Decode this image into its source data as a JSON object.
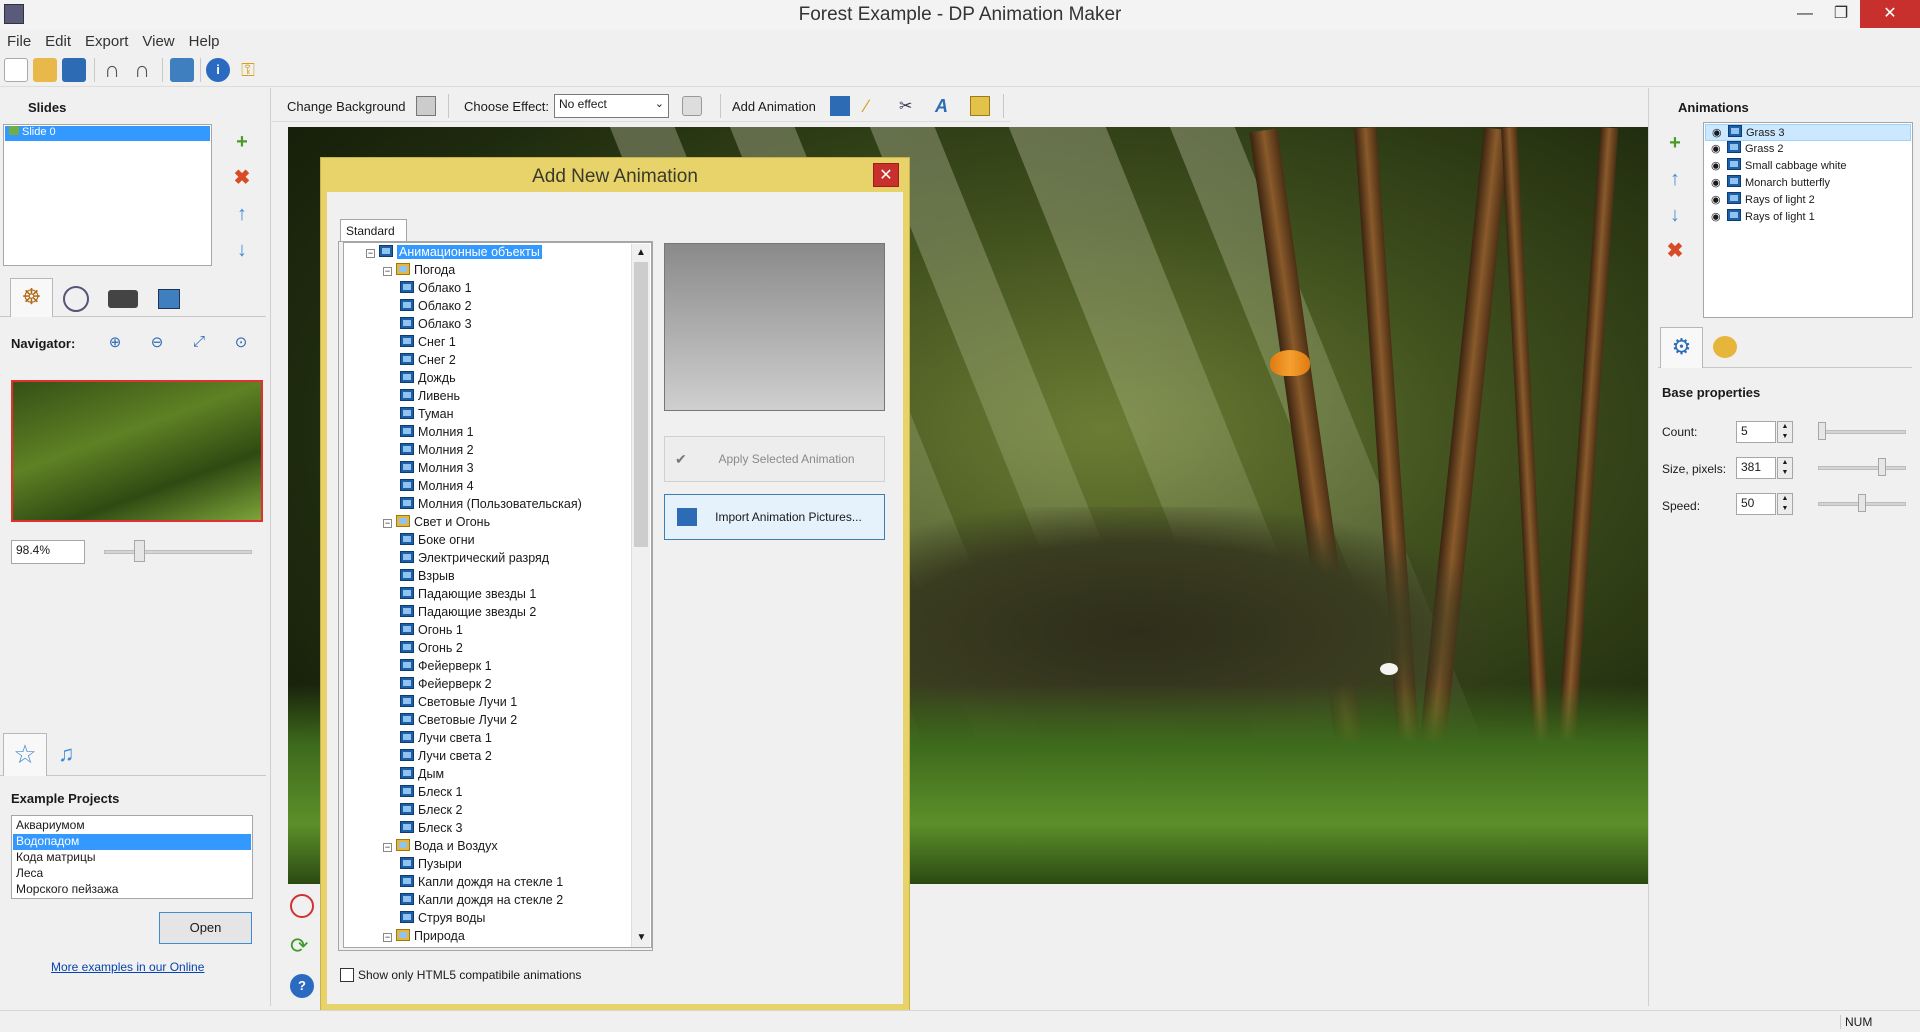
{
  "window": {
    "title": "Forest Example - DP Animation Maker"
  },
  "menu": [
    "File",
    "Edit",
    "Export",
    "View",
    "Help"
  ],
  "toolbar2": {
    "change_background": "Change Background",
    "choose_effect": "Choose Effect:",
    "effect_value": "No effect",
    "add_animation": "Add Animation"
  },
  "slides": {
    "header": "Slides",
    "items": [
      "Slide 0"
    ]
  },
  "navigator": {
    "label": "Navigator:",
    "zoom": "98.4%"
  },
  "examples": {
    "header": "Example Projects",
    "items": [
      "Аквариумом",
      "Водопадом",
      "Кода матрицы",
      "Леса",
      "Морского пейзажа"
    ],
    "selected": "Водопадом",
    "open_button": "Open",
    "link": "More examples in our Online"
  },
  "dialog": {
    "title": "Add New Animation",
    "tab": "Standard",
    "apply_button": "Apply Selected Animation",
    "import_button": "Import Animation Pictures...",
    "checkbox_label": "Show only HTML5 compatibile animations",
    "tree": [
      {
        "text": "Анимационные объекты",
        "level": 0,
        "kind": "root"
      },
      {
        "text": "Погода",
        "level": 1,
        "kind": "folder"
      },
      {
        "text": "Облако 1",
        "level": 2,
        "kind": "item"
      },
      {
        "text": "Облако 2",
        "level": 2,
        "kind": "item"
      },
      {
        "text": "Облако 3",
        "level": 2,
        "kind": "item"
      },
      {
        "text": "Снег 1",
        "level": 2,
        "kind": "item"
      },
      {
        "text": "Снег 2",
        "level": 2,
        "kind": "item"
      },
      {
        "text": "Дождь",
        "level": 2,
        "kind": "item"
      },
      {
        "text": "Ливень",
        "level": 2,
        "kind": "item"
      },
      {
        "text": "Туман",
        "level": 2,
        "kind": "item"
      },
      {
        "text": "Молния 1",
        "level": 2,
        "kind": "item"
      },
      {
        "text": "Молния 2",
        "level": 2,
        "kind": "item"
      },
      {
        "text": "Молния 3",
        "level": 2,
        "kind": "item"
      },
      {
        "text": "Молния 4",
        "level": 2,
        "kind": "item"
      },
      {
        "text": "Молния (Пользовательская)",
        "level": 2,
        "kind": "item"
      },
      {
        "text": "Свет и Огонь",
        "level": 1,
        "kind": "folder"
      },
      {
        "text": "Боке огни",
        "level": 2,
        "kind": "item"
      },
      {
        "text": "Электрический разряд",
        "level": 2,
        "kind": "item"
      },
      {
        "text": "Взрыв",
        "level": 2,
        "kind": "item"
      },
      {
        "text": "Падающие звезды 1",
        "level": 2,
        "kind": "item"
      },
      {
        "text": "Падающие звезды 2",
        "level": 2,
        "kind": "item"
      },
      {
        "text": "Огонь 1",
        "level": 2,
        "kind": "item"
      },
      {
        "text": "Огонь 2",
        "level": 2,
        "kind": "item"
      },
      {
        "text": "Фейерверк 1",
        "level": 2,
        "kind": "item"
      },
      {
        "text": "Фейерверк 2",
        "level": 2,
        "kind": "item"
      },
      {
        "text": "Световые Лучи 1",
        "level": 2,
        "kind": "item"
      },
      {
        "text": "Световые Лучи 2",
        "level": 2,
        "kind": "item"
      },
      {
        "text": "Лучи света 1",
        "level": 2,
        "kind": "item"
      },
      {
        "text": "Лучи света 2",
        "level": 2,
        "kind": "item"
      },
      {
        "text": "Дым",
        "level": 2,
        "kind": "item"
      },
      {
        "text": "Блеск 1",
        "level": 2,
        "kind": "item"
      },
      {
        "text": "Блеск 2",
        "level": 2,
        "kind": "item"
      },
      {
        "text": "Блеск 3",
        "level": 2,
        "kind": "item"
      },
      {
        "text": "Вода и Воздух",
        "level": 1,
        "kind": "folder"
      },
      {
        "text": "Пузыри",
        "level": 2,
        "kind": "item"
      },
      {
        "text": "Капли дождя на стекле 1",
        "level": 2,
        "kind": "item"
      },
      {
        "text": "Капли дождя на стекле 2",
        "level": 2,
        "kind": "item"
      },
      {
        "text": "Струя воды",
        "level": 2,
        "kind": "item"
      },
      {
        "text": "Природа",
        "level": 1,
        "kind": "folder"
      }
    ]
  },
  "animations": {
    "header": "Animations",
    "items": [
      "Grass 3",
      "Grass 2",
      "Small cabbage white",
      "Monarch butterfly",
      "Rays of light 2",
      "Rays of light 1"
    ],
    "selected": "Grass 3"
  },
  "properties": {
    "header": "Base properties",
    "count_label": "Count:",
    "count": "5",
    "size_label": "Size, pixels:",
    "size": "381",
    "speed_label": "Speed:",
    "speed": "50"
  },
  "status": {
    "num": "NUM"
  },
  "colors": {
    "selection": "#3399ff",
    "dialog_frame": "#e8d36a",
    "close": "#c7302c"
  }
}
